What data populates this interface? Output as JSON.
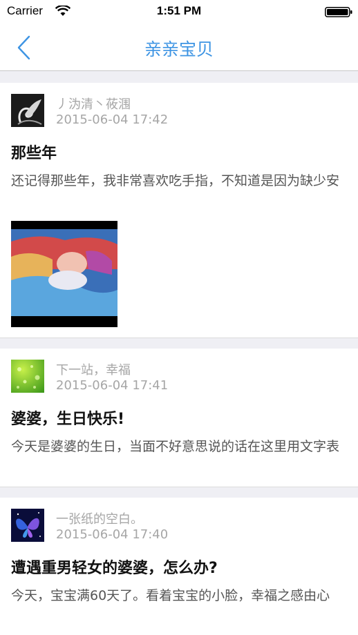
{
  "status": {
    "carrier": "Carrier",
    "time": "1:51 PM"
  },
  "nav": {
    "title": "亲亲宝贝",
    "back_icon": "chevron-left-icon"
  },
  "colors": {
    "accent": "#3d94e3",
    "meta_text": "#a6a6a6",
    "body_text": "#555555",
    "background": "#efeff4"
  },
  "posts": [
    {
      "author": "丿沩清丶莜涠",
      "date": "2015-06-04 17:42",
      "title": "那些年",
      "body": "还记得那些年，我非常喜欢吃手指，不知道是因为缺少安",
      "avatar": "swan-avatar",
      "has_photo": true
    },
    {
      "author": "下一站，幸福",
      "date": "2015-06-04 17:41",
      "title": "婆婆，生日快乐!",
      "body": "今天是婆婆的生日，当面不好意思说的话在这里用文字表",
      "avatar": "green-droplets-avatar",
      "has_photo": false
    },
    {
      "author": "一张纸的空白。",
      "date": "2015-06-04 17:40",
      "title": "遭遇重男轻女的婆婆，怎么办?",
      "body": " 今天，宝宝满60天了。看着宝宝的小脸，幸福之感由心",
      "avatar": "blue-butterfly-avatar",
      "has_photo": false
    }
  ]
}
